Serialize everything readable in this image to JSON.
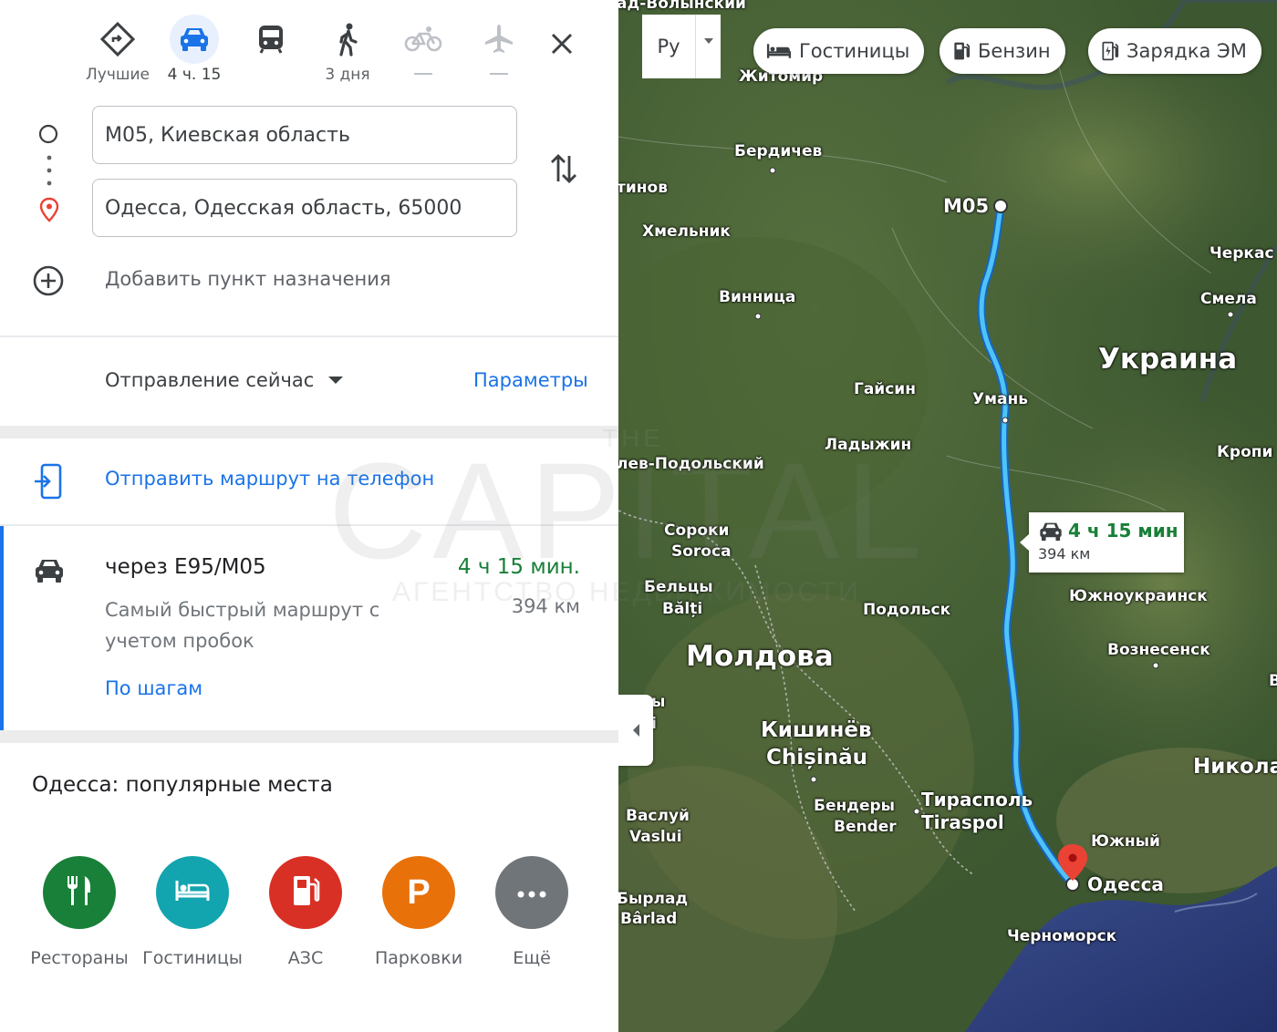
{
  "modes": [
    {
      "label": "Лучшие",
      "icon": "directions-icon",
      "selected": false
    },
    {
      "label": "4 ч. 15",
      "icon": "car-icon",
      "selected": true
    },
    {
      "label": "",
      "icon": "transit-icon",
      "selected": false
    },
    {
      "label": "3 дня",
      "icon": "walk-icon",
      "selected": false
    },
    {
      "label": "—",
      "icon": "bicycle-icon",
      "selected": false
    },
    {
      "label": "—",
      "icon": "flight-icon",
      "selected": false
    }
  ],
  "origin": {
    "value": "М05, Киевская область"
  },
  "destination": {
    "value": "Одесса, Одесская область, 65000"
  },
  "add_destination": "Добавить пункт назначения",
  "departure": {
    "label": "Отправление сейчас",
    "options_label": "Параметры"
  },
  "send_to_phone": "Отправить маршрут на телефон",
  "route": {
    "via": "через E95/M05",
    "time": "4 ч 15 мин.",
    "note": "Самый быстрый маршрут с учетом пробок",
    "distance": "394 км",
    "steps_label": "По шагам"
  },
  "popular": {
    "title": "Одесса: популярные места",
    "items": [
      {
        "label": "Рестораны",
        "icon": "restaurant-icon",
        "color": "#188038"
      },
      {
        "label": "Гостиницы",
        "icon": "hotel-icon",
        "color": "#12a4af"
      },
      {
        "label": "АЗС",
        "icon": "gas-station-icon",
        "color": "#d93025"
      },
      {
        "label": "Парковки",
        "icon": "parking-icon",
        "color": "#e8710a",
        "glyph": "P"
      },
      {
        "label": "Ещё",
        "icon": "more-icon",
        "color": "#70757a"
      }
    ]
  },
  "map": {
    "lang_label": "Ру",
    "chips": [
      "Гостиницы",
      "Бензин",
      "Зарядка ЭМ"
    ],
    "route_box": {
      "time": "4 ч 15 мин",
      "distance": "394 км"
    },
    "labels": {
      "top_cut": "ад-Волынский",
      "zhytomyr": "Житомир",
      "berdychiv": "Бердичев",
      "tynov": "тинов",
      "khmelnyk": "Хмельник",
      "m05": "M05",
      "cherkasy": "Черкас",
      "smila": "Смела",
      "vinnytsia": "Винница",
      "ukraine": "Украина",
      "haisyn": "Гайсин",
      "uman": "Умань",
      "ladyzhyn": "Ладыжин",
      "podilsky": "лев-Подольский",
      "kropy": "Кропи",
      "soroky": "Сороки",
      "soroca": "Soroca",
      "beltsy": "Бельцы",
      "balti": "Bălți",
      "podolsk": "Подольск",
      "yuzhnoukrainsk": "Южноукраинск",
      "moldova": "Молдова",
      "voznesensk": "Вознесенск",
      "b_cut": "В",
      "yi_cut": "ы",
      "i_cut": "i",
      "kishinev": "Кишинёв",
      "chisinau": "Chișinău",
      "nikolaev": "Никола",
      "bendery": "Бендеры",
      "bender": "Bender",
      "tiraspol": "Тирасполь",
      "tiraspol_lat": "Tiraspol",
      "vaslui": "Васлуй",
      "vaslui_lat": "Vaslui",
      "yuzhny": "Южный",
      "odessa": "Одесса",
      "barlad": "Бырлад",
      "barlad_lat": "Bârlad",
      "chernomorsk": "Черноморск",
      "watermark_the": "THE",
      "watermark": "CAPITAL",
      "watermark_sub": "АГЕНТСТВО НЕДВИЖИМОСТИ"
    }
  }
}
